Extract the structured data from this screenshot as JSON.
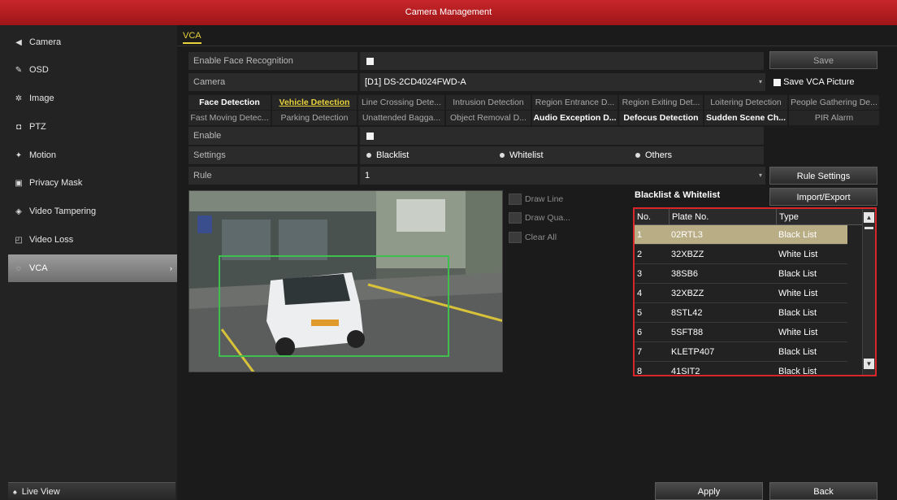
{
  "window": {
    "title": "Camera Management"
  },
  "sidebar": {
    "items": [
      {
        "label": "Camera",
        "icon": "camera-icon",
        "glyph": "◀"
      },
      {
        "label": "OSD",
        "icon": "osd-icon",
        "glyph": "✎"
      },
      {
        "label": "Image",
        "icon": "image-icon",
        "glyph": "✲"
      },
      {
        "label": "PTZ",
        "icon": "ptz-icon",
        "glyph": "◘"
      },
      {
        "label": "Motion",
        "icon": "motion-icon",
        "glyph": "✦"
      },
      {
        "label": "Privacy Mask",
        "icon": "privacy-mask-icon",
        "glyph": "▣"
      },
      {
        "label": "Video Tampering",
        "icon": "video-tampering-icon",
        "glyph": "◈"
      },
      {
        "label": "Video Loss",
        "icon": "video-loss-icon",
        "glyph": "◰"
      },
      {
        "label": "VCA",
        "icon": "vca-icon",
        "glyph": "◌",
        "active": true
      }
    ],
    "live_view": {
      "label": "Live View",
      "glyph": "♠"
    }
  },
  "tab": {
    "label": "VCA"
  },
  "form": {
    "enable_face_label": "Enable Face Recognition",
    "camera_label": "Camera",
    "camera_value": "[D1] DS-2CD4024FWD-A",
    "save_vca_picture_label": "Save VCA Picture",
    "enable_label": "Enable",
    "settings_label": "Settings",
    "settings_options": [
      "Blacklist",
      "Whitelist",
      "Others"
    ],
    "rule_label": "Rule",
    "rule_value": "1"
  },
  "buttons": {
    "save": "Save",
    "rule_settings": "Rule Settings",
    "import_export": "Import/Export",
    "apply": "Apply",
    "back": "Back"
  },
  "detection_row1": [
    "Face Detection",
    "Vehicle Detection",
    "Line Crossing Dete...",
    "Intrusion Detection",
    "Region Entrance D...",
    "Region Exiting Det...",
    "Loitering Detection",
    "People Gathering De..."
  ],
  "detection_row2": [
    "Fast Moving Detec...",
    "Parking Detection",
    "Unattended Bagga...",
    "Object Removal D...",
    "Audio Exception D...",
    "Defocus Detection",
    "Sudden Scene Ch...",
    "PIR Alarm"
  ],
  "draw_tools": [
    "Draw Line",
    "Draw Qua...",
    "Clear All"
  ],
  "list": {
    "title": "Blacklist & Whitelist",
    "columns": [
      "No.",
      "Plate No.",
      "Type"
    ],
    "rows": [
      {
        "no": "1",
        "plate": "02RTL3",
        "type": "Black List"
      },
      {
        "no": "2",
        "plate": "32XBZZ",
        "type": "White List"
      },
      {
        "no": "3",
        "plate": "38SB6",
        "type": "Black List"
      },
      {
        "no": "4",
        "plate": "32XBZZ",
        "type": "White List"
      },
      {
        "no": "5",
        "plate": "8STL42",
        "type": "Black List"
      },
      {
        "no": "6",
        "plate": "5SFT88",
        "type": "White List"
      },
      {
        "no": "7",
        "plate": "KLETP407",
        "type": "Black List"
      },
      {
        "no": "8",
        "plate": "41SIT2",
        "type": "Black List"
      }
    ]
  },
  "colors": {
    "accent": "#e8d23b",
    "title_red": "#c8262a",
    "highlight_border": "#d8262b",
    "selected_row": "#b9ad86"
  }
}
